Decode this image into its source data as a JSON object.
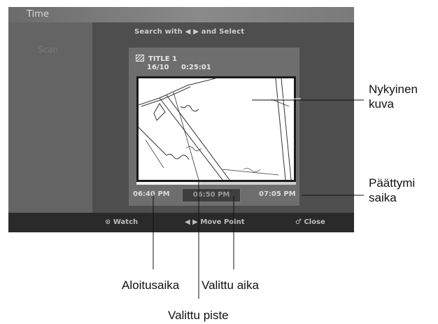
{
  "osd": {
    "title": "Time",
    "sidebar_faint": "Scan",
    "hint": "Search with ◀ ▶ and Select",
    "title_name": "TITLE 1",
    "title_date": "16/10",
    "title_duration": "0:25:01",
    "start_time": "06:40 PM",
    "selected_time": "06:50 PM",
    "end_time": "07:05 PM",
    "timeline_position": 0.4,
    "footer": {
      "watch": "⊙ Watch",
      "move": "◀ ▶ Move Point",
      "close": "♂ Close"
    }
  },
  "callouts": {
    "current_picture_line1": "Nykyinen",
    "current_picture_line2": "kuva",
    "end_time_line1": "Päättymi",
    "end_time_line2": "saika",
    "start_time": "Aloitusaika",
    "selected_time": "Valittu aika",
    "selected_point": "Valittu piste"
  }
}
